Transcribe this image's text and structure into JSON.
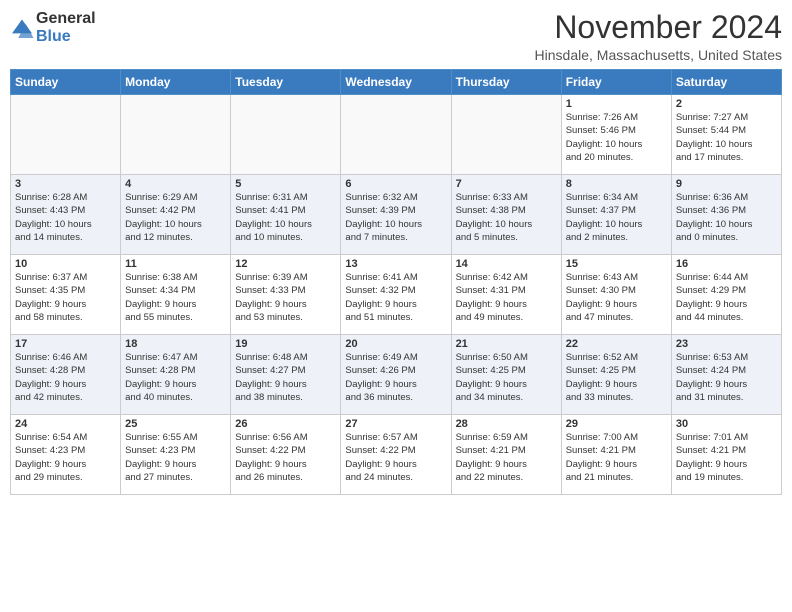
{
  "header": {
    "logo_general": "General",
    "logo_blue": "Blue",
    "month": "November 2024",
    "location": "Hinsdale, Massachusetts, United States"
  },
  "weekdays": [
    "Sunday",
    "Monday",
    "Tuesday",
    "Wednesday",
    "Thursday",
    "Friday",
    "Saturday"
  ],
  "weeks": [
    [
      {
        "day": "",
        "info": ""
      },
      {
        "day": "",
        "info": ""
      },
      {
        "day": "",
        "info": ""
      },
      {
        "day": "",
        "info": ""
      },
      {
        "day": "",
        "info": ""
      },
      {
        "day": "1",
        "info": "Sunrise: 7:26 AM\nSunset: 5:46 PM\nDaylight: 10 hours\nand 20 minutes."
      },
      {
        "day": "2",
        "info": "Sunrise: 7:27 AM\nSunset: 5:44 PM\nDaylight: 10 hours\nand 17 minutes."
      }
    ],
    [
      {
        "day": "3",
        "info": "Sunrise: 6:28 AM\nSunset: 4:43 PM\nDaylight: 10 hours\nand 14 minutes."
      },
      {
        "day": "4",
        "info": "Sunrise: 6:29 AM\nSunset: 4:42 PM\nDaylight: 10 hours\nand 12 minutes."
      },
      {
        "day": "5",
        "info": "Sunrise: 6:31 AM\nSunset: 4:41 PM\nDaylight: 10 hours\nand 10 minutes."
      },
      {
        "day": "6",
        "info": "Sunrise: 6:32 AM\nSunset: 4:39 PM\nDaylight: 10 hours\nand 7 minutes."
      },
      {
        "day": "7",
        "info": "Sunrise: 6:33 AM\nSunset: 4:38 PM\nDaylight: 10 hours\nand 5 minutes."
      },
      {
        "day": "8",
        "info": "Sunrise: 6:34 AM\nSunset: 4:37 PM\nDaylight: 10 hours\nand 2 minutes."
      },
      {
        "day": "9",
        "info": "Sunrise: 6:36 AM\nSunset: 4:36 PM\nDaylight: 10 hours\nand 0 minutes."
      }
    ],
    [
      {
        "day": "10",
        "info": "Sunrise: 6:37 AM\nSunset: 4:35 PM\nDaylight: 9 hours\nand 58 minutes."
      },
      {
        "day": "11",
        "info": "Sunrise: 6:38 AM\nSunset: 4:34 PM\nDaylight: 9 hours\nand 55 minutes."
      },
      {
        "day": "12",
        "info": "Sunrise: 6:39 AM\nSunset: 4:33 PM\nDaylight: 9 hours\nand 53 minutes."
      },
      {
        "day": "13",
        "info": "Sunrise: 6:41 AM\nSunset: 4:32 PM\nDaylight: 9 hours\nand 51 minutes."
      },
      {
        "day": "14",
        "info": "Sunrise: 6:42 AM\nSunset: 4:31 PM\nDaylight: 9 hours\nand 49 minutes."
      },
      {
        "day": "15",
        "info": "Sunrise: 6:43 AM\nSunset: 4:30 PM\nDaylight: 9 hours\nand 47 minutes."
      },
      {
        "day": "16",
        "info": "Sunrise: 6:44 AM\nSunset: 4:29 PM\nDaylight: 9 hours\nand 44 minutes."
      }
    ],
    [
      {
        "day": "17",
        "info": "Sunrise: 6:46 AM\nSunset: 4:28 PM\nDaylight: 9 hours\nand 42 minutes."
      },
      {
        "day": "18",
        "info": "Sunrise: 6:47 AM\nSunset: 4:28 PM\nDaylight: 9 hours\nand 40 minutes."
      },
      {
        "day": "19",
        "info": "Sunrise: 6:48 AM\nSunset: 4:27 PM\nDaylight: 9 hours\nand 38 minutes."
      },
      {
        "day": "20",
        "info": "Sunrise: 6:49 AM\nSunset: 4:26 PM\nDaylight: 9 hours\nand 36 minutes."
      },
      {
        "day": "21",
        "info": "Sunrise: 6:50 AM\nSunset: 4:25 PM\nDaylight: 9 hours\nand 34 minutes."
      },
      {
        "day": "22",
        "info": "Sunrise: 6:52 AM\nSunset: 4:25 PM\nDaylight: 9 hours\nand 33 minutes."
      },
      {
        "day": "23",
        "info": "Sunrise: 6:53 AM\nSunset: 4:24 PM\nDaylight: 9 hours\nand 31 minutes."
      }
    ],
    [
      {
        "day": "24",
        "info": "Sunrise: 6:54 AM\nSunset: 4:23 PM\nDaylight: 9 hours\nand 29 minutes."
      },
      {
        "day": "25",
        "info": "Sunrise: 6:55 AM\nSunset: 4:23 PM\nDaylight: 9 hours\nand 27 minutes."
      },
      {
        "day": "26",
        "info": "Sunrise: 6:56 AM\nSunset: 4:22 PM\nDaylight: 9 hours\nand 26 minutes."
      },
      {
        "day": "27",
        "info": "Sunrise: 6:57 AM\nSunset: 4:22 PM\nDaylight: 9 hours\nand 24 minutes."
      },
      {
        "day": "28",
        "info": "Sunrise: 6:59 AM\nSunset: 4:21 PM\nDaylight: 9 hours\nand 22 minutes."
      },
      {
        "day": "29",
        "info": "Sunrise: 7:00 AM\nSunset: 4:21 PM\nDaylight: 9 hours\nand 21 minutes."
      },
      {
        "day": "30",
        "info": "Sunrise: 7:01 AM\nSunset: 4:21 PM\nDaylight: 9 hours\nand 19 minutes."
      }
    ]
  ]
}
